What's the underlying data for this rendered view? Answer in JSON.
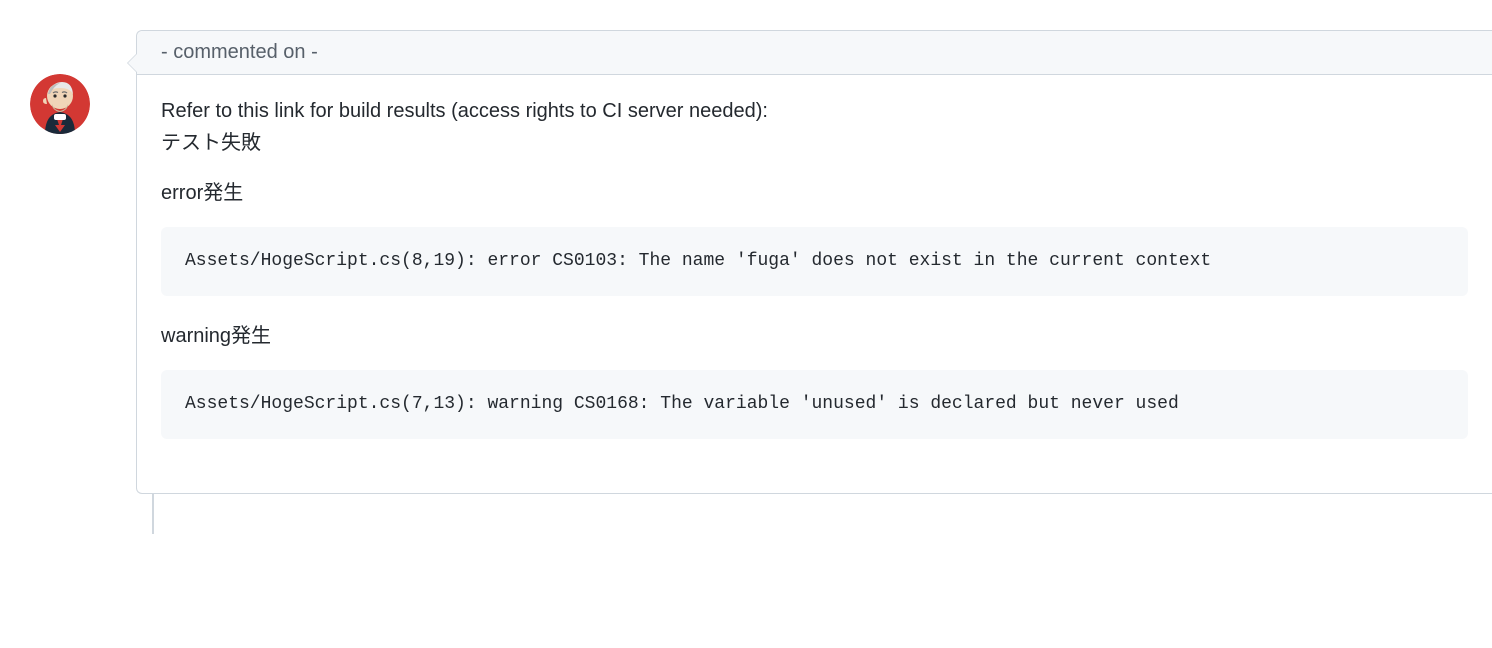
{
  "header": {
    "author_placeholder": "-",
    "action": "commented",
    "on": "on",
    "date_placeholder": "-"
  },
  "body": {
    "line1": "Refer to this link for build results (access rights to CI server needed):",
    "line2": "テスト失敗",
    "error_heading": "error発生",
    "error_code": "Assets/HogeScript.cs(8,19): error CS0103: The name 'fuga' does not exist in the current context",
    "warning_heading": "warning発生",
    "warning_code": "Assets/HogeScript.cs(7,13): warning CS0168: The variable 'unused' is declared but never used"
  },
  "avatar": {
    "name": "jenkins-avatar"
  }
}
